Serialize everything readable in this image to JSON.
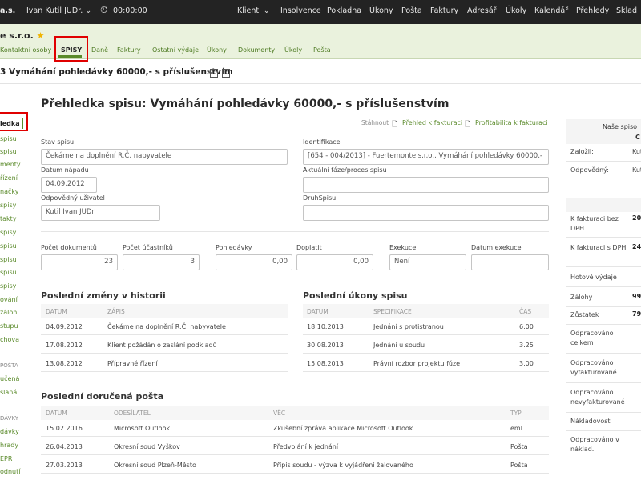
{
  "topbar": {
    "company": "a.s.",
    "user": "Ivan Kutil JUDr.",
    "timer": "00:00:00",
    "nav": [
      "Klienti",
      "Insolvence",
      "Pokladna",
      "Úkony",
      "Pošta",
      "Faktury",
      "Adresář",
      "Úkoly",
      "Kalendář",
      "Přehledy",
      "Sklad"
    ]
  },
  "client": {
    "name": "e s.r.o.",
    "tabs": [
      "Kontaktní osoby",
      "SPISY",
      "Daně",
      "Faktury",
      "Ostatní výdaje",
      "Úkony",
      "Dokumenty",
      "Úkoly",
      "Pošta"
    ],
    "active_tab": "SPISY"
  },
  "case_title": "3 Vymáhání pohledávky 60000,- s příslušenstvím",
  "left_nav": [
    "ledka",
    "spisu",
    "spisu",
    "menty",
    "řízení",
    "načky",
    "spisy",
    "takty",
    "spisy",
    "spisu",
    "spisu",
    "spisu",
    "spisy",
    "ování",
    "záloh",
    "stupu",
    "chova",
    "POŠTA",
    "učená",
    "slaná",
    "DÁVKY",
    "dávky",
    "hrady",
    "EPR",
    "odnutí"
  ],
  "main": {
    "heading": "Přehledka spisu: Vymáhání pohledávky 60000,- s příslušenstvím",
    "downloads_label": "Stáhnout",
    "download_links": [
      "Přehled k fakturaci",
      "Profitabilita k fakturaci"
    ],
    "fields": {
      "stav_label": "Stav spisu",
      "stav_value": "Čekáme na doplnění R.Č. nabyvatele",
      "datum_label": "Datum nápadu",
      "datum_value": "04.09.2012",
      "odpovedny_label": "Odpovědný uživatel",
      "odpovedny_value": "Kutil Ivan  JUDr.",
      "identifikace_label": "Identifikace",
      "identifikace_value": "[654 - 004/2013] - Fuertemonte s.r.o., Vymáhání pohledávky 60000,-",
      "faze_label": "Aktuální fáze/proces spisu",
      "faze_value": "",
      "druh_label": "DruhSpisu",
      "druh_value": ""
    },
    "stats": [
      {
        "label": "Počet dokumentů",
        "value": "23"
      },
      {
        "label": "Počet účastníků",
        "value": "3"
      },
      {
        "label": "Pohledávky",
        "value": "0,00"
      },
      {
        "label": "Doplatit",
        "value": "0,00"
      },
      {
        "label": "Exekuce",
        "value": "Není"
      },
      {
        "label": "Datum exekuce",
        "value": ""
      }
    ],
    "history": {
      "title": "Poslední změny v historii",
      "headers": [
        "DATUM",
        "ZÁPIS"
      ],
      "rows": [
        [
          "04.09.2012",
          "Čekáme na doplnění R.Č. nabyvatele"
        ],
        [
          "17.08.2012",
          "Klient požádán o zaslání podkladů"
        ],
        [
          "13.08.2012",
          "Přípravné řízení"
        ]
      ]
    },
    "ukony": {
      "title": "Poslední úkony spisu",
      "headers": [
        "DATUM",
        "SPECIFIKACE",
        "ČAS"
      ],
      "rows": [
        [
          "18.10.2013",
          "Jednání s protistranou",
          "6.00"
        ],
        [
          "30.08.2013",
          "Jednání u soudu",
          "3.25"
        ],
        [
          "15.08.2013",
          "Právní rozbor projektu fúze",
          "3.00"
        ]
      ]
    },
    "posta": {
      "title": "Poslední doručená pošta",
      "headers": [
        "DATUM",
        "ODESÍLATEL",
        "VĚC",
        "TYP"
      ],
      "rows": [
        [
          "15.02.2016",
          "Microsoft Outlook",
          "Zkušební zpráva aplikace Microsoft Outlook",
          "eml"
        ],
        [
          "26.04.2013",
          "Okresní soud Vyškov",
          "Předvolání k jednání",
          "Pošta"
        ],
        [
          "27.03.2013",
          "Okresní soud Plzeň-Město",
          "Přípis soudu - výzva k vyjádření žalovaného",
          "Pošta"
        ]
      ]
    }
  },
  "right_panel": {
    "header": "Naše spiso",
    "header_sub": "C",
    "top_rows": [
      {
        "label": "Založil:",
        "value": "Kutil I"
      },
      {
        "label": "Odpovědný:",
        "value": "Kutil I"
      }
    ],
    "fin_rows": [
      {
        "label": "K fakturaci bez DPH",
        "value": "20."
      },
      {
        "label": "K fakturaci s DPH",
        "value": "24."
      },
      {
        "label": "Hotové výdaje",
        "value": ""
      },
      {
        "label": "Zálohy",
        "value": "99."
      },
      {
        "label": "Zůstatek",
        "value": "79."
      },
      {
        "label": "Odpracováno celkem",
        "value": ""
      },
      {
        "label": "Odpracováno vyfakturované",
        "value": ""
      },
      {
        "label": "Odpracováno nevyfakturované",
        "value": ""
      },
      {
        "label": "Nákladovost",
        "value": ""
      },
      {
        "label": "Odpracováno v náklad.",
        "value": ""
      }
    ]
  },
  "colors": {
    "topbar": "#232323",
    "accent_green": "#4d7a22",
    "subbar": "#eaf2dd",
    "highlight": "#e00000"
  }
}
